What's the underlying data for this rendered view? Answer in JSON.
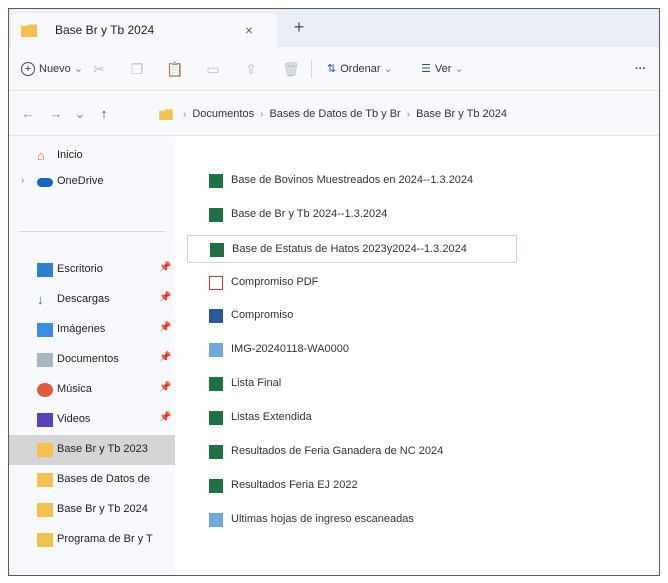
{
  "tab": {
    "title": "Base Br y Tb 2024",
    "close": "×",
    "new": "+"
  },
  "toolbar": {
    "new_label": "Nuevo",
    "sort_label": "Ordenar",
    "view_label": "Ver",
    "more_label": "···"
  },
  "address": {
    "crumbs": [
      "Documentos",
      "Bases de Datos de Tb y Br",
      "Base Br y Tb 2024"
    ]
  },
  "sidebar": {
    "items": [
      {
        "label": "Inicio"
      },
      {
        "label": "OneDrive"
      },
      {
        "label": "Escritorio"
      },
      {
        "label": "Descargas"
      },
      {
        "label": "Imágenes"
      },
      {
        "label": "Documentos"
      },
      {
        "label": "Música"
      },
      {
        "label": "Videos"
      },
      {
        "label": "Base Br y Tb 2023"
      },
      {
        "label": "Bases de Datos de"
      },
      {
        "label": "Base Br y Tb 2024"
      },
      {
        "label": "Programa de Br y T"
      }
    ]
  },
  "files": [
    {
      "name": "Base de Bovinos Muestreados en 2024--1.3.2024",
      "type": "excel"
    },
    {
      "name": "Base de Br y Tb 2024--1.3.2024",
      "type": "excel"
    },
    {
      "name": "Base de Estatus de Hatos 2023y2024--1.3.2024",
      "type": "excel"
    },
    {
      "name": "Compromiso PDF",
      "type": "pdf"
    },
    {
      "name": "Compromiso",
      "type": "word"
    },
    {
      "name": "IMG-20240118-WA0000",
      "type": "image"
    },
    {
      "name": "Lista Final",
      "type": "excel"
    },
    {
      "name": "Listas Extendida",
      "type": "excel"
    },
    {
      "name": "Resultados de Feria Ganadera de NC 2024",
      "type": "excel"
    },
    {
      "name": "Resultados Feria EJ 2022",
      "type": "excel"
    },
    {
      "name": "Ultimas hojas de ingreso escaneadas",
      "type": "image"
    }
  ]
}
